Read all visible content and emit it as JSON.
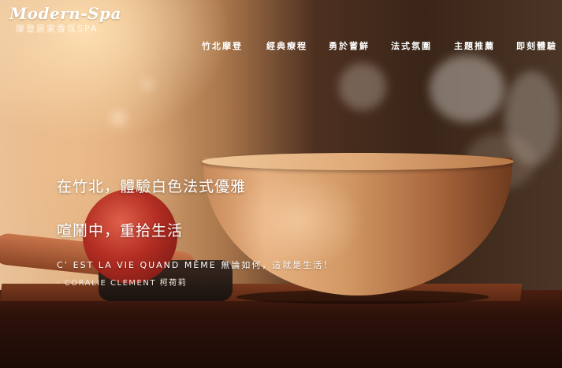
{
  "logo": {
    "script_text": "Modern-Spa",
    "subtitle": "摩登居家香氛SPA"
  },
  "nav": {
    "items": [
      {
        "label": "竹北摩登"
      },
      {
        "label": "經典療程"
      },
      {
        "label": "勇於嘗鮮"
      },
      {
        "label": "法式氛圍"
      },
      {
        "label": "主題推薦"
      },
      {
        "label": "即刻體驗"
      }
    ]
  },
  "hero": {
    "headline_1": "在竹北，體驗白色法式優雅",
    "headline_2": "喧鬧中，重拾生活",
    "quote": "C’ EST LA VIE QUAND MÊME 無論如何，這就是生活！",
    "quote_author": "- CORALIE CLEMENT 柯荷莉"
  }
}
